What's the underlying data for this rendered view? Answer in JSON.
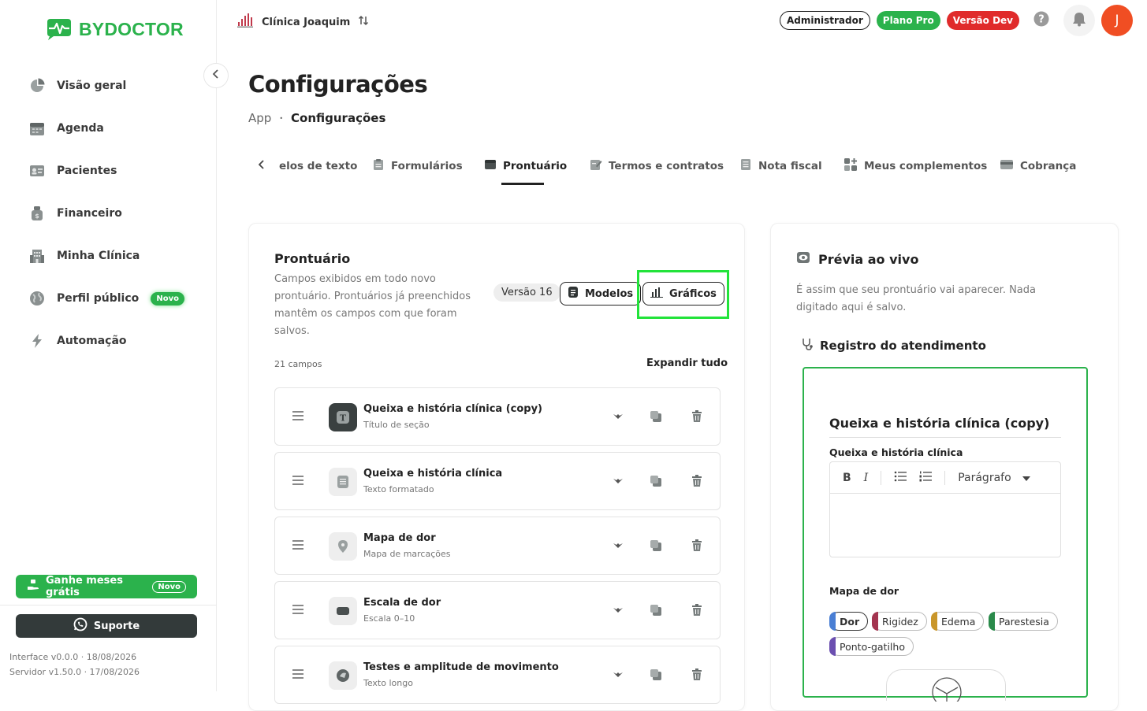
{
  "brand": {
    "name": "BYDOCTOR",
    "color": "#2bb24c"
  },
  "sidebar": {
    "items": [
      {
        "label": "Visão geral",
        "icon": "pie-chart-icon"
      },
      {
        "label": "Agenda",
        "icon": "calendar-icon"
      },
      {
        "label": "Pacientes",
        "icon": "id-card-icon"
      },
      {
        "label": "Financeiro",
        "icon": "money-bag-icon"
      },
      {
        "label": "Minha Clínica",
        "icon": "building-icon"
      },
      {
        "label": "Perfil público",
        "icon": "globe-icon",
        "badge": "Novo"
      },
      {
        "label": "Automação",
        "icon": "lightning-icon"
      }
    ],
    "promo": {
      "label": "Ganhe meses grátis",
      "badge": "Novo"
    },
    "support": "Suporte",
    "interface_version": "Interface v0.0.0 · 18/08/2026",
    "server_version": "Servidor v1.50.0 · 17/08/2026"
  },
  "topbar": {
    "clinic": "Clínica Joaquim",
    "role": "Administrador",
    "plan": "Plano Pro",
    "env": "Versão Dev",
    "avatar_initial": "J"
  },
  "page": {
    "title": "Configurações",
    "breadcrumb": [
      "App",
      "Configurações"
    ]
  },
  "tabs": [
    {
      "label": "Modelos de texto",
      "shown": "elos de texto",
      "icon": "document-icon"
    },
    {
      "label": "Formulários",
      "icon": "clipboard-icon"
    },
    {
      "label": "Prontuário",
      "icon": "folder-icon",
      "active": true
    },
    {
      "label": "Termos e contratos",
      "icon": "signature-icon"
    },
    {
      "label": "Nota fiscal",
      "icon": "receipt-icon"
    },
    {
      "label": "Meus complementos",
      "icon": "add-apps-icon"
    },
    {
      "label": "Cobrança",
      "icon": "card-icon"
    }
  ],
  "prontuario": {
    "title": "Prontuário",
    "description": "Campos exibidos em todo novo prontuário. Prontuários já preenchidos mantêm os campos com que foram salvos.",
    "version": "Versão 16",
    "models_button": "Modelos",
    "charts_button": "Gráficos",
    "fields_count": "21 campos",
    "expand_all": "Expandir tudo",
    "fields": [
      {
        "name": "Queixa e história clínica (copy)",
        "type": "Título de seção",
        "icon": "text-title-icon"
      },
      {
        "name": "Queixa e história clínica",
        "type": "Texto formatado",
        "icon": "formatted-text-icon"
      },
      {
        "name": "Mapa de dor",
        "type": "Mapa de marcações",
        "icon": "map-pin-icon"
      },
      {
        "name": "Escala de dor",
        "type": "Escala 0–10",
        "icon": "scale-icon"
      },
      {
        "name": "Testes e amplitude de movimento",
        "type": "Texto longo",
        "icon": "long-text-icon"
      }
    ]
  },
  "preview": {
    "title": "Prévia ao vivo",
    "description": "É assim que seu prontuário vai aparecer. Nada digitado aqui é salvo.",
    "subtitle": "Registro do atendimento",
    "section_heading": "Queixa e história clínica (copy)",
    "editor_label": "Queixa e história clínica",
    "paragraph_select": "Parágrafo",
    "pain_map_label": "Mapa de dor",
    "chips": [
      {
        "label": "Dor",
        "color": "#4a7fd4",
        "selected": true
      },
      {
        "label": "Rigidez",
        "color": "#a3344f"
      },
      {
        "label": "Edema",
        "color": "#c9962a"
      },
      {
        "label": "Parestesia",
        "color": "#2a8a4a"
      },
      {
        "label": "Ponto-gatilho",
        "color": "#6b4fb0"
      }
    ]
  }
}
